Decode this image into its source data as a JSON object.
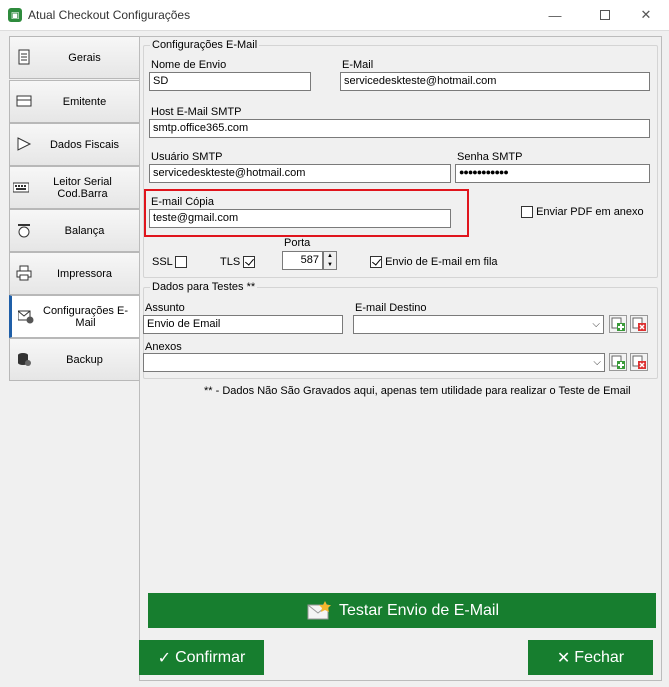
{
  "window": {
    "title": "Atual Checkout Configurações",
    "minimize": "—",
    "close": "✕"
  },
  "tabs": [
    {
      "label": "Gerais",
      "icon": "document-icon"
    },
    {
      "label": "Emitente",
      "icon": "card-icon"
    },
    {
      "label": "Dados Fiscais",
      "icon": "flag-icon"
    },
    {
      "label": "Leitor Serial Cod.Barra",
      "icon": "keyboard-icon"
    },
    {
      "label": "Balança",
      "icon": "scale-icon"
    },
    {
      "label": "Impressora",
      "icon": "printer-icon"
    },
    {
      "label": "Configurações E-Mail",
      "icon": "email-settings-icon",
      "active": true
    },
    {
      "label": "Backup",
      "icon": "database-icon"
    }
  ],
  "email_config": {
    "group_title": "Configurações E-Mail",
    "nome_envio_label": "Nome de Envio",
    "nome_envio_value": "SD",
    "email_label": "E-Mail",
    "email_value": "servicedeskteste@hotmail.com",
    "host_label": "Host E-Mail SMTP",
    "host_value": "smtp.office365.com",
    "usuario_label": "Usuário SMTP",
    "usuario_value": "servicedeskteste@hotmail.com",
    "senha_label": "Senha SMTP",
    "senha_value": "●●●●●●●●●●●",
    "copia_label": "E-mail Cópia",
    "copia_value": "teste@gmail.com",
    "enviar_pdf_label": "Enviar PDF em anexo",
    "enviar_pdf_checked": false,
    "ssl_label": "SSL",
    "ssl_checked": false,
    "tls_label": "TLS",
    "tls_checked": true,
    "porta_label": "Porta",
    "porta_value": "587",
    "fila_label": "Envio de E-mail em fila",
    "fila_checked": true
  },
  "testes": {
    "group_title": "Dados para Testes **",
    "assunto_label": "Assunto",
    "assunto_value": "Envio de Email",
    "destino_label": "E-mail Destino",
    "destino_value": "",
    "anexos_label": "Anexos",
    "anexos_value": "",
    "note": "** - Dados Não São Gravados aqui, apenas tem utilidade para realizar o Teste de Email"
  },
  "buttons": {
    "testar": "Testar Envio de E-Mail",
    "confirmar": "Confirmar",
    "fechar": "Fechar"
  },
  "colors": {
    "green": "#177e2f",
    "highlight": "#e0141c",
    "active_tab": "#1f5fa8"
  }
}
